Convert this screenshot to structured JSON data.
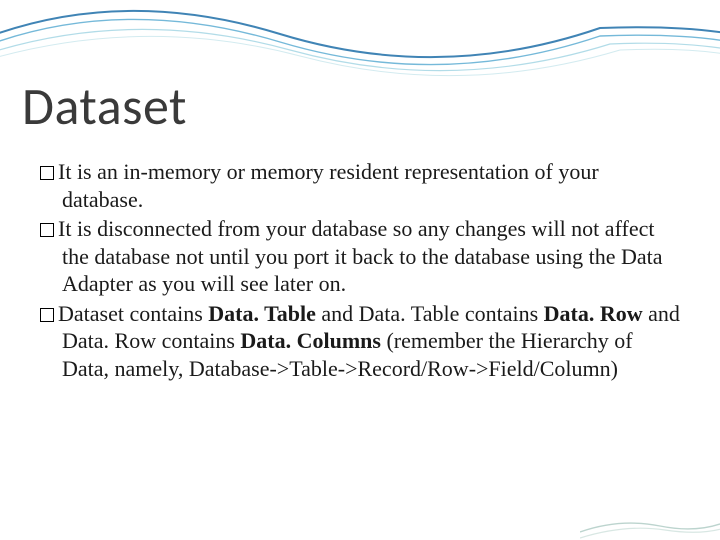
{
  "title": "Dataset",
  "bullets": [
    {
      "segments": [
        {
          "text": "It is an in-memory or memory resident representation of your database.",
          "bold": false
        }
      ]
    },
    {
      "segments": [
        {
          "text": "It is disconnected from your database so any changes will not affect the database not until you port it back to the database using the Data Adapter as you will see later on.",
          "bold": false
        }
      ]
    },
    {
      "segments": [
        {
          "text": "Dataset contains ",
          "bold": false
        },
        {
          "text": "Data. Table",
          "bold": true
        },
        {
          "text": " and Data. Table contains ",
          "bold": false
        },
        {
          "text": "Data. Row",
          "bold": true
        },
        {
          "text": " and Data. Row contains ",
          "bold": false
        },
        {
          "text": "Data. Columns",
          "bold": true
        },
        {
          "text": " (remember the Hierarchy of Data, namely, Database->Table->Record/Row->Field/Column)",
          "bold": false
        }
      ]
    }
  ]
}
